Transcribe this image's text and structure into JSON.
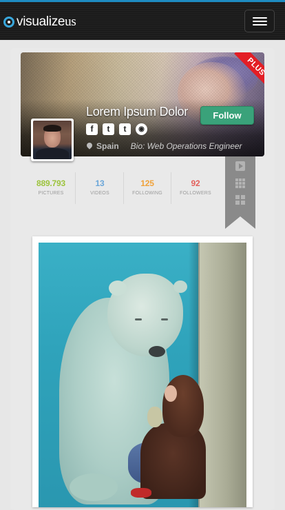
{
  "navbar": {
    "logo_text_main": "visualize",
    "logo_text_suffix": "us",
    "menu_icon": "hamburger-menu-icon"
  },
  "profile": {
    "badge": "PLUS",
    "name": "Lorem Ipsum Dolor",
    "follow_label": "Follow",
    "location": "Spain",
    "bio": "Bio: Web Operations Engineer",
    "socials": [
      {
        "icon": "facebook-icon",
        "glyph": "f"
      },
      {
        "icon": "twitter-icon",
        "glyph": "t"
      },
      {
        "icon": "tumblr-icon",
        "glyph": "t"
      },
      {
        "icon": "globe-icon",
        "glyph": "◉"
      }
    ]
  },
  "stats": [
    {
      "value": "889.793",
      "label": "Pictures",
      "color": "#9cc33c"
    },
    {
      "value": "13",
      "label": "Videos",
      "color": "#6aa6d9"
    },
    {
      "value": "125",
      "label": "Following",
      "color": "#f0a23a"
    },
    {
      "value": "92",
      "label": "Followers",
      "color": "#e3605b"
    }
  ],
  "side_ribbon": {
    "icons": [
      "video-icon",
      "grid-view-icon",
      "tiles-view-icon"
    ]
  },
  "colors": {
    "accent": "#1e8cc2",
    "follow": "#3aa27a",
    "badge": "#e31e25"
  }
}
